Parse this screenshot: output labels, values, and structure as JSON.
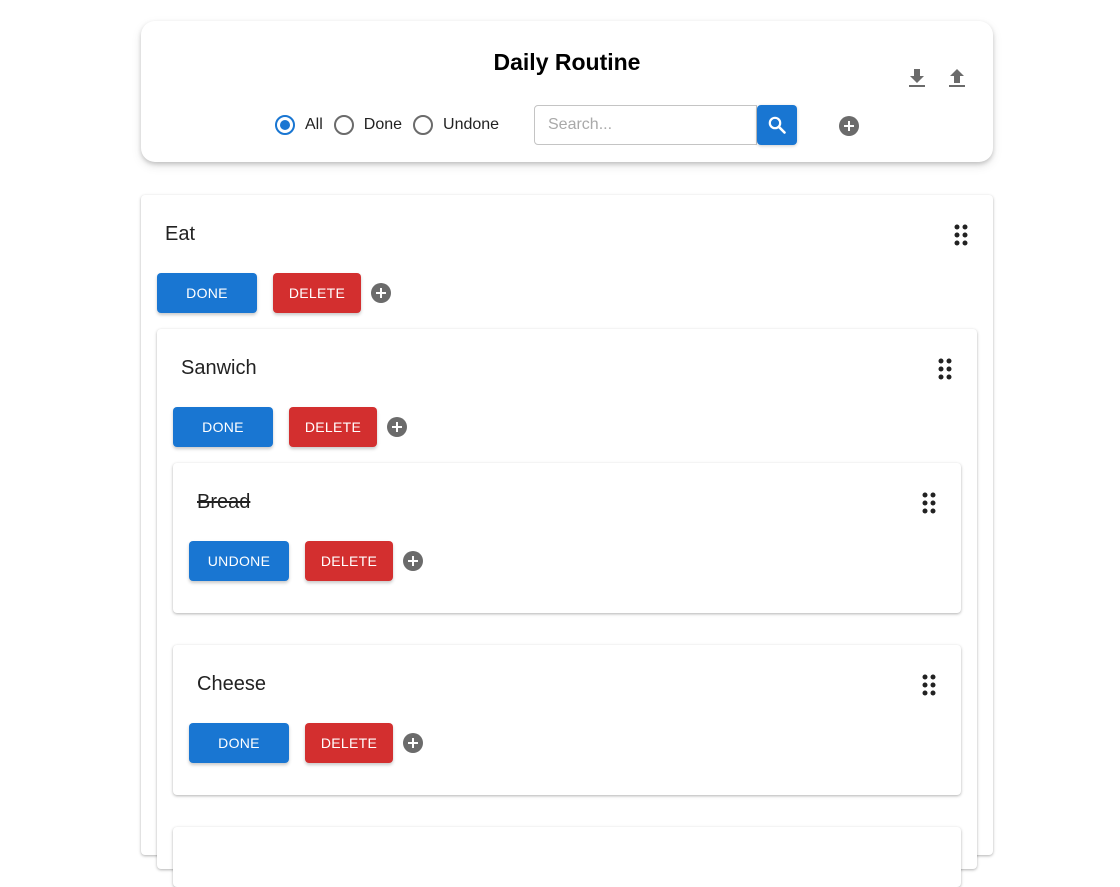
{
  "app": {
    "title": "Daily Routine",
    "download_icon": "download-icon",
    "upload_icon": "upload-icon"
  },
  "filter": {
    "options": [
      "All",
      "Done",
      "Undone"
    ],
    "selected": "All"
  },
  "search": {
    "placeholder": "Search...",
    "value": "",
    "icon": "search-icon"
  },
  "colors": {
    "primary": "#1976d2",
    "danger": "#d32f2f",
    "icon_gray": "#6b6b6b"
  },
  "tasks": {
    "eat": {
      "title": "Eat",
      "toggle_label": "DONE",
      "delete_label": "DELETE"
    },
    "sanwich": {
      "title": "Sanwich",
      "toggle_label": "DONE",
      "delete_label": "DELETE"
    },
    "bread": {
      "title": "Bread",
      "completed": true,
      "toggle_label": "UNDONE",
      "delete_label": "DELETE"
    },
    "cheese": {
      "title": "Cheese",
      "toggle_label": "DONE",
      "delete_label": "DELETE"
    }
  }
}
